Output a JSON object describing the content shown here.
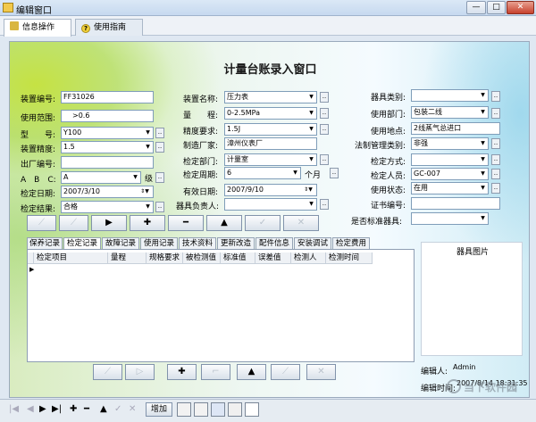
{
  "window": {
    "title": "编辑窗口",
    "min": "—",
    "max": "□",
    "close": "✕"
  },
  "topTabs": [
    {
      "label": "信息操作"
    },
    {
      "label": "使用指南",
      "icon": "?"
    }
  ],
  "page": {
    "title": "计量台账录入窗口"
  },
  "form": {
    "zhuangzhi_bianhao": {
      "label": "装置编号:",
      "value": "FF31026"
    },
    "shiyong_fanwei": {
      "label": "使用范围:",
      "value": ">0.6"
    },
    "xinghao": {
      "label": "型　　号:",
      "value": "Y100"
    },
    "zhuangzhi_jingdu": {
      "label": "装置精度:",
      "value": "1.5"
    },
    "chuchang_bianhao": {
      "label": "出厂编号:",
      "value": ""
    },
    "abc": {
      "label": "A　B　C:",
      "value": "A",
      "suffix": "级"
    },
    "jiance_riqi": {
      "label": "检定日期:",
      "value": "2007/3/10"
    },
    "jiance_jieguo": {
      "label": "检定结果:",
      "value": "合格"
    },
    "zhuangzhi_mingcheng": {
      "label": "装置名称:",
      "value": "压力表"
    },
    "liangcheng": {
      "label": "量　　程:",
      "value": "0-2.5MPa"
    },
    "jingdu_yaoqiu": {
      "label": "精度要求:",
      "value": "1.5J"
    },
    "zhizao_changjia": {
      "label": "制造厂家:",
      "value": "漳州仪表厂"
    },
    "jiance_bumen": {
      "label": "检定部门:",
      "value": "计量室"
    },
    "jiance_zhouqi": {
      "label": "检定周期:",
      "value": "6",
      "suffix": "个月"
    },
    "youxiao_riqi": {
      "label": "有效日期:",
      "value": "2007/9/10"
    },
    "qiju_fuzeren": {
      "label": "器具负责人:",
      "value": ""
    },
    "qiju_leibie": {
      "label": "器具类别:",
      "value": ""
    },
    "shiyong_bumen": {
      "label": "使用部门:",
      "value": "包装二线"
    },
    "shiyong_didian": {
      "label": "使用地点:",
      "value": "2线蒸气总进口"
    },
    "fazhi_guanli_leibie": {
      "label": "法制管理类别:",
      "value": "非强"
    },
    "jiance_fangshi": {
      "label": "检定方式:",
      "value": ""
    },
    "jiance_renyuan": {
      "label": "检定人员:",
      "value": "GC-007"
    },
    "shiyong_zhuangtai": {
      "label": "使用状态:",
      "value": "在用"
    },
    "zhengshu_bianhao": {
      "label": "证书编号:",
      "value": ""
    },
    "shifou_biaozhun": {
      "label": "是否标准器具:",
      "value": ""
    }
  },
  "recordTabs": [
    {
      "label": "保养记录"
    },
    {
      "label": "检定记录"
    },
    {
      "label": "故障记录"
    },
    {
      "label": "使用记录"
    },
    {
      "label": "技术资料"
    },
    {
      "label": "更新改造"
    },
    {
      "label": "配件信息"
    },
    {
      "label": "安装调试"
    },
    {
      "label": "检定费用"
    }
  ],
  "gridColumns": [
    {
      "label": "检定项目"
    },
    {
      "label": "量程"
    },
    {
      "label": "规格要求"
    },
    {
      "label": "被检测值"
    },
    {
      "label": "标准值"
    },
    {
      "label": "误差值"
    },
    {
      "label": "检测人"
    },
    {
      "label": "检测时间"
    }
  ],
  "imagePanel": {
    "title": "器具图片"
  },
  "meta": {
    "editorLabel": "编辑人:",
    "editorValue": "Admin",
    "timeLabel": "编辑时间:",
    "timeValue": "2007/8/14 18:31:35"
  },
  "bottom": {
    "add_label": "增加"
  },
  "watermark": "当下软件园"
}
